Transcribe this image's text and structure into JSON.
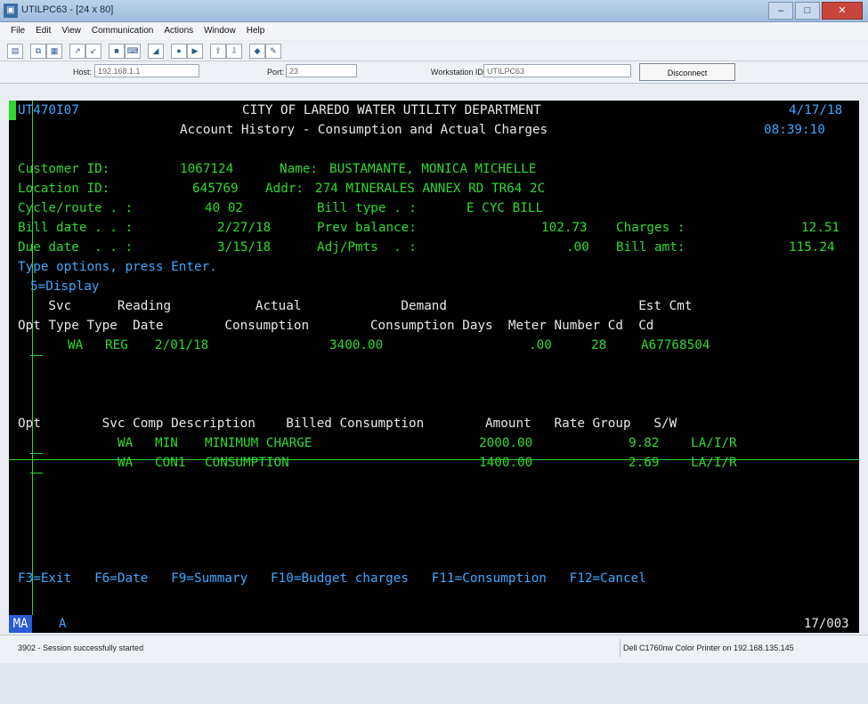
{
  "window": {
    "title": "UTILPC63 - [24 x 80]",
    "controls": {
      "minimize": "–",
      "maximize": "□",
      "close": "✕"
    }
  },
  "menu": [
    "File",
    "Edit",
    "View",
    "Communication",
    "Actions",
    "Window",
    "Help"
  ],
  "hostbar": {
    "host_label": "Host:",
    "host_value": "192.168.1.1",
    "port_label": "Port:",
    "port_value": "23",
    "workstation_label": "Workstation ID:",
    "workstation_value": "UTILPC63",
    "disconnect_label": "Disconnect"
  },
  "terminal": {
    "program_id": "UT470I07",
    "title": "CITY OF LAREDO WATER UTILITY DEPARTMENT",
    "date": "4/17/18",
    "subtitle": "Account History - Consumption and Actual Charges",
    "time": "08:39:10",
    "customer_id_label": "Customer ID:",
    "customer_id": "1067124",
    "name_label": "Name:",
    "name": "BUSTAMANTE, MONICA MICHELLE",
    "location_id_label": "Location ID:",
    "location_id": "645769",
    "addr_label": "Addr:",
    "addr": "274 MINERALES ANNEX RD TR64 2C",
    "cycle_label": "Cycle/route . :",
    "cycle": "40 02",
    "bill_type_label": "Bill type . :",
    "bill_type": "E CYC BILL",
    "bill_date_label": "Bill date . . :",
    "bill_date": "2/27/18",
    "prev_balance_label": "Prev balance:",
    "prev_balance": "102.73",
    "charges_label": "Charges :",
    "charges": "12.51",
    "due_date_label": "Due date  . . :",
    "due_date": "3/15/18",
    "adj_label": "Adj/Pmts  . :",
    "adj": ".00",
    "bill_amt_label": "Bill amt:",
    "bill_amt": "115.24",
    "instructions": "Type options, press Enter.",
    "option_5": "5=Display",
    "upper_header_1": "    Svc      Reading           Actual             Demand                         Est Cmt",
    "upper_header_2": "Opt Type Type  Date        Consumption        Consumption Days  Meter Number Cd  Cd",
    "reading_row": {
      "svc_type": "WA",
      "reading_type": "REG",
      "date": "2/01/18",
      "actual_consumption": "3400.00",
      "demand_consumption": ".00",
      "days": "28",
      "meter_number": "A67768504"
    },
    "lower_header": "Opt        Svc Comp Description    Billed Consumption        Amount   Rate Group   S/W",
    "charge_rows": [
      {
        "svc": "WA",
        "comp": "MIN",
        "description": "MINIMUM CHARGE",
        "billed_consumption": "2000.00",
        "amount": "9.82",
        "rate_group": "LA/I/R"
      },
      {
        "svc": "WA",
        "comp": "CON1",
        "description": "CONSUMPTION",
        "billed_consumption": "1400.00",
        "amount": "2.69",
        "rate_group": "LA/I/R"
      }
    ],
    "function_keys": "F3=Exit   F6=Date   F9=Summary   F10=Budget charges   F11=Consumption   F12=Cancel"
  },
  "oia": {
    "mode": "MA",
    "indicator": "A",
    "cursor_pos": "17/003"
  },
  "status_bar": {
    "message": "3902 - Session successfully started",
    "printer": "Dell C1760nw Color Printer on 192.168.135.145"
  },
  "colors": {
    "terminal_green": "#2ed92e",
    "terminal_blue": "#3ea8ff",
    "terminal_white": "#e8e8e8",
    "background": "#000000"
  }
}
